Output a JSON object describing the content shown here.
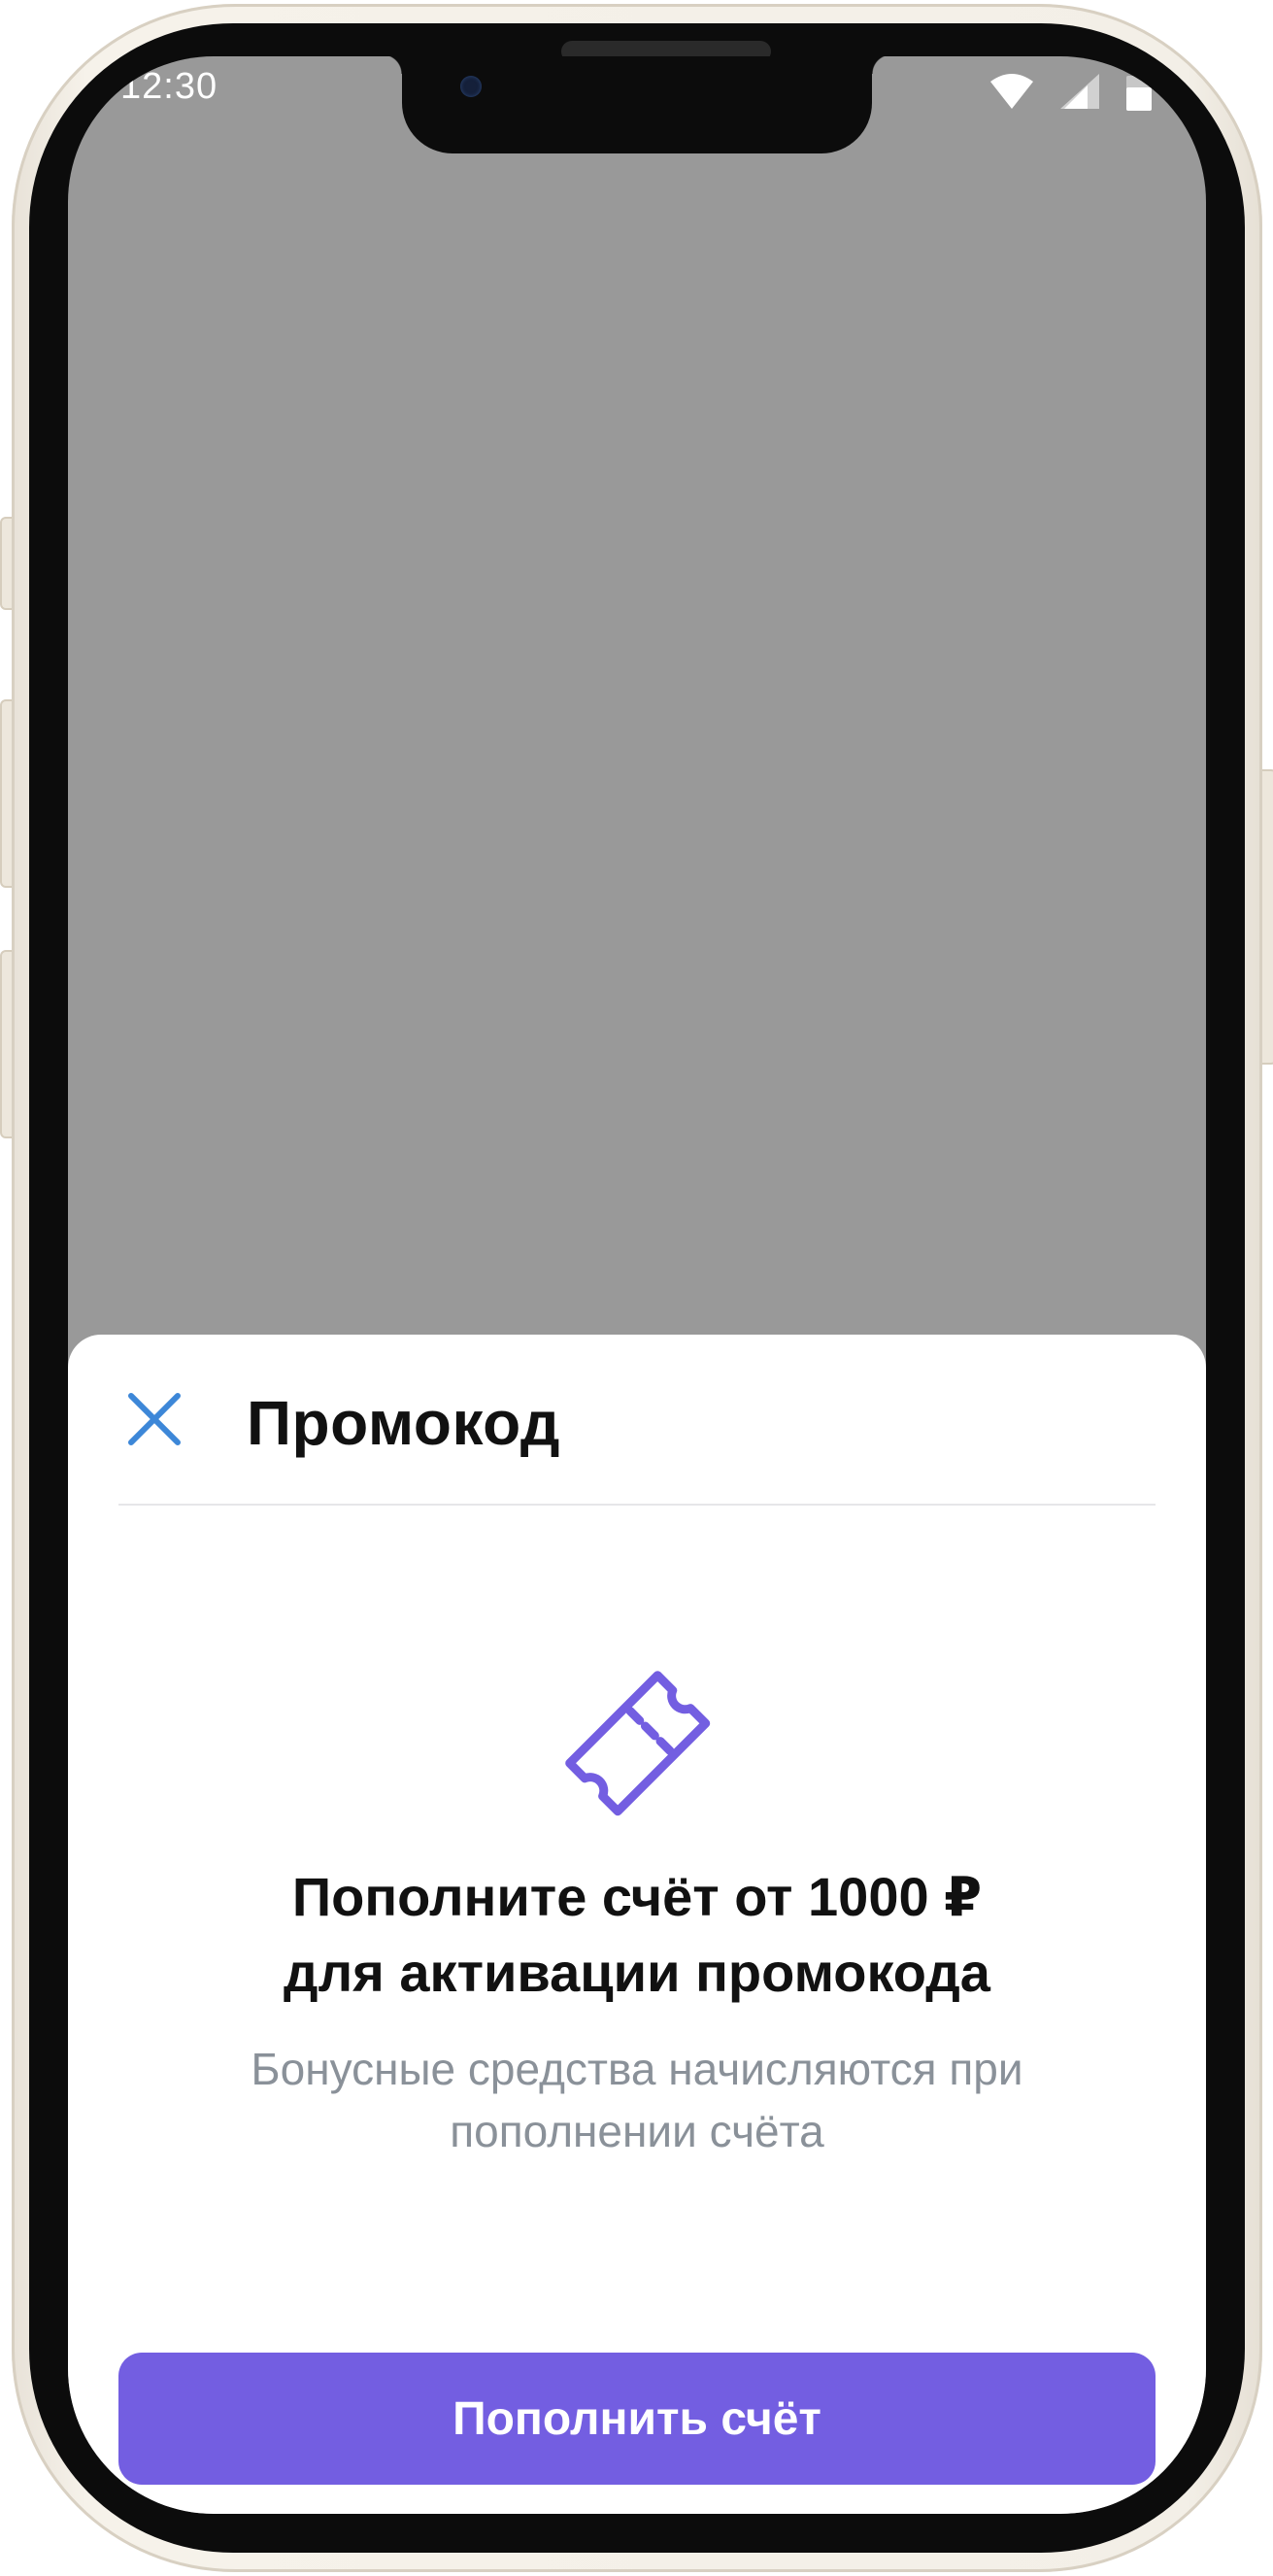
{
  "status_bar": {
    "time": "12:30",
    "icons": [
      "wifi-icon",
      "cellular-signal-icon",
      "battery-icon"
    ]
  },
  "sheet": {
    "title": "Промокод",
    "close_icon": "close-icon",
    "illustration_icon": "ticket-icon",
    "heading_line1": "Пополните счёт от 1000 ₽",
    "heading_line2": "для активации промокода",
    "subtitle_line1": "Бонусные средства начисляются при",
    "subtitle_line2": "пополнении счёта",
    "button_label": "Пополнить счёт"
  },
  "colors": {
    "accent": "#735ee1",
    "close_icon": "#3d87d8",
    "backdrop": "#999999",
    "subtitle": "#8a9199"
  }
}
